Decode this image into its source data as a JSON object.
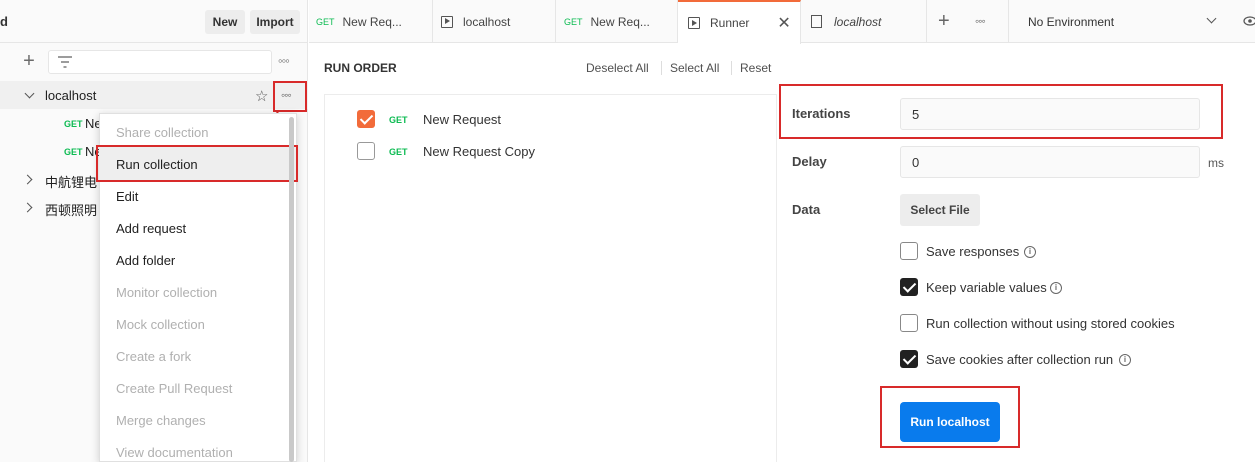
{
  "sidebar": {
    "title_fragment": "d",
    "new_label": "New",
    "import_label": "Import",
    "collection": {
      "name": "localhost",
      "requests": [
        {
          "method": "GET",
          "name_fragment": "Ne"
        },
        {
          "method": "GET",
          "name_fragment": "Ne"
        }
      ]
    },
    "other_collections": [
      "中航锂电",
      "西顿照明"
    ]
  },
  "context_menu": {
    "items": [
      {
        "label": "Share collection",
        "enabled": false
      },
      {
        "label": "Run collection",
        "enabled": true,
        "highlighted": true
      },
      {
        "label": "Edit",
        "enabled": true
      },
      {
        "label": "Add request",
        "enabled": true
      },
      {
        "label": "Add folder",
        "enabled": true
      },
      {
        "label": "Monitor collection",
        "enabled": false
      },
      {
        "label": "Mock collection",
        "enabled": false
      },
      {
        "label": "Create a fork",
        "enabled": false
      },
      {
        "label": "Create Pull Request",
        "enabled": false
      },
      {
        "label": "Merge changes",
        "enabled": false
      },
      {
        "label": "View documentation",
        "enabled": false
      }
    ]
  },
  "tabs": [
    {
      "method": "GET",
      "label": "New Req..."
    },
    {
      "icon": "runner-icon",
      "label": "localhost"
    },
    {
      "method": "GET",
      "label": "New Req..."
    },
    {
      "icon": "runner-icon",
      "label": "Runner",
      "active": true
    },
    {
      "icon": "collection-doc-icon",
      "label": "localhost"
    }
  ],
  "environment": {
    "selected": "No Environment"
  },
  "run_order": {
    "title": "RUN ORDER",
    "deselect_all": "Deselect All",
    "select_all": "Select All",
    "reset": "Reset",
    "requests": [
      {
        "method": "GET",
        "name": "New Request",
        "checked": true
      },
      {
        "method": "GET",
        "name": "New Request Copy",
        "checked": false
      }
    ]
  },
  "config": {
    "iterations_label": "Iterations",
    "iterations_value": "5",
    "delay_label": "Delay",
    "delay_value": "0",
    "delay_unit": "ms",
    "data_label": "Data",
    "select_file_label": "Select File",
    "options": [
      {
        "label": "Save responses",
        "checked": false,
        "info": true
      },
      {
        "label": "Keep variable values",
        "checked": true,
        "info": true
      },
      {
        "label": "Run collection without using stored cookies",
        "checked": false,
        "info": false
      },
      {
        "label": "Save cookies after collection run",
        "checked": true,
        "info": true
      }
    ],
    "run_button_label": "Run localhost"
  },
  "colors": {
    "accent_orange": "#f26b3a",
    "run_button_blue": "#097bed",
    "get_method_green": "#0cbb52",
    "annotation_red": "#d82a2a"
  }
}
